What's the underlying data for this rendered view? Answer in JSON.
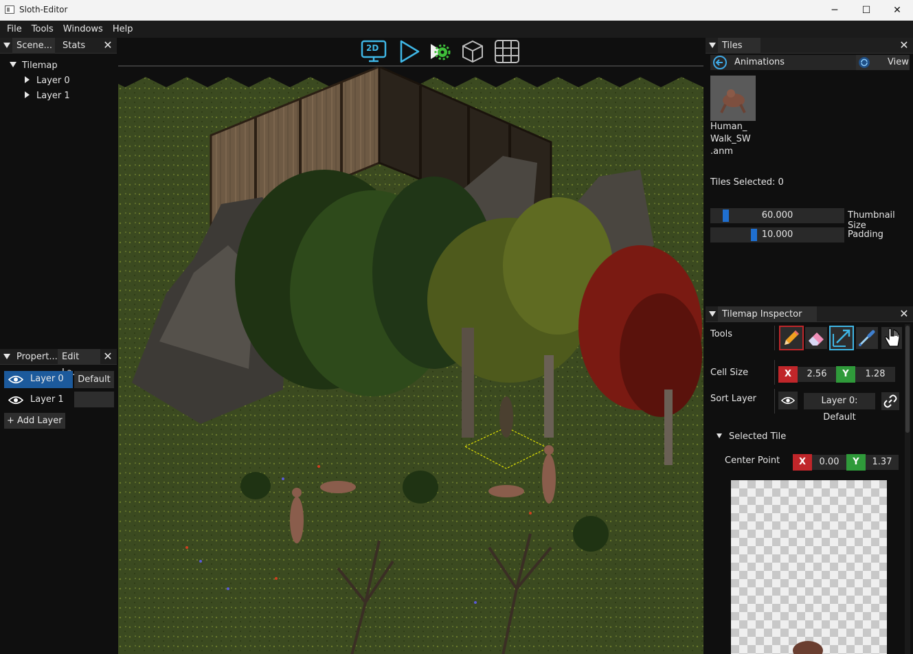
{
  "window": {
    "title": "Sloth-Editor",
    "min": "─",
    "max": "☐",
    "close": "✕"
  },
  "menu": [
    "File",
    "Tools",
    "Windows",
    "Help"
  ],
  "scene_panel": {
    "tabs": [
      "Scene...",
      "Stats"
    ],
    "close": "✕",
    "tree": {
      "root": "Tilemap",
      "children": [
        "Layer 0",
        "Layer 1"
      ]
    }
  },
  "props_panel": {
    "tabs": [
      "Propert...",
      "Edit La..."
    ],
    "close": "✕",
    "layers": [
      {
        "name": "Layer 0",
        "sort": "Default"
      },
      {
        "name": "Layer 1",
        "sort": ""
      }
    ],
    "add_layer": "+ Add Layer"
  },
  "viewport": {
    "toolbar": {
      "mode_2d": "2D",
      "icons": [
        "monitor-2d-icon",
        "play-icon",
        "play-gear-icon",
        "cube-icon",
        "grid-icon"
      ]
    }
  },
  "tiles_panel": {
    "tab": "Tiles",
    "close": "✕",
    "back_label": "Animations",
    "view_label": "View",
    "asset": {
      "name_lines": [
        "Human_",
        "Walk_SW",
        ".anm"
      ]
    },
    "tiles_selected": "Tiles Selected: 0",
    "thumbnail_size": {
      "value": "60.000",
      "label": "Thumbnail Size"
    },
    "padding": {
      "value": "10.000",
      "label": "Padding"
    }
  },
  "inspector": {
    "tab": "Tilemap Inspector",
    "close": "✕",
    "tools_label": "Tools",
    "tool_icons": [
      "pencil-icon",
      "eraser-icon",
      "resize-icon",
      "eyedropper-icon",
      "hand-icon"
    ],
    "cell_size": {
      "label": "Cell Size",
      "x_tag": "X",
      "x": "2.56",
      "y_tag": "Y",
      "y": "1.28"
    },
    "sort_layer": {
      "label": "Sort Layer",
      "value": "Layer 0: Default"
    },
    "selected_tile": {
      "header": "Selected Tile",
      "center_label": "Center Point",
      "x_tag": "X",
      "x": "0.00",
      "y_tag": "Y",
      "y": "1.37"
    }
  },
  "colors": {
    "accent_blue": "#1f6fd0",
    "active_layer_bg": "#1c5a9c",
    "x_red": "#c0262a",
    "y_green": "#2f9a3a",
    "toolbar_cyan": "#3fb7e6"
  }
}
